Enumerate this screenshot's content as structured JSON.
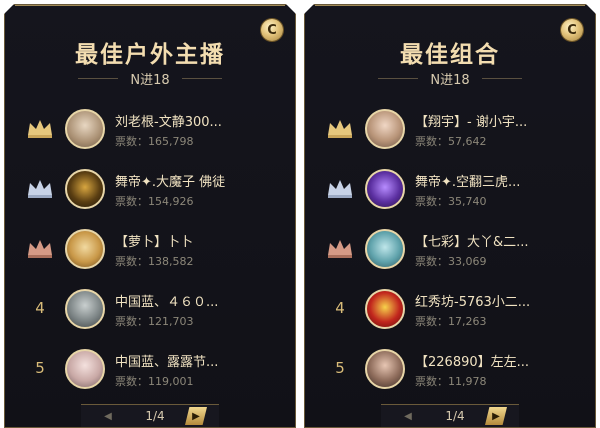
{
  "colors": {
    "gold": "#d9bc79",
    "title": "#f3ddb0",
    "panel_bg": "#15151d",
    "border": "#6a5a3a"
  },
  "panels": [
    {
      "title": "最佳户外主播",
      "subtitle": "N进18",
      "badge": "C",
      "pager": {
        "prev": "◀",
        "next": "▶",
        "text": "1/4"
      },
      "entries": [
        {
          "rank": "1",
          "rank_type": "crown-gold",
          "name": "刘老根-文静300...",
          "votes": "票数：165,798",
          "avatar": "avatar-1"
        },
        {
          "rank": "2",
          "rank_type": "crown-silver",
          "name": "舞帝✦.大魔子 佛徒",
          "votes": "票数：154,926",
          "avatar": "avatar-2"
        },
        {
          "rank": "3",
          "rank_type": "crown-bronze",
          "name": "【萝卜】卜卜",
          "votes": "票数：138,582",
          "avatar": "avatar-3"
        },
        {
          "rank": "4",
          "rank_type": "number",
          "name": "中国蓝、４６０...",
          "votes": "票数：121,703",
          "avatar": "avatar-4"
        },
        {
          "rank": "5",
          "rank_type": "number",
          "name": "中国蓝、露露节...",
          "votes": "票数：119,001",
          "avatar": "avatar-5"
        }
      ]
    },
    {
      "title": "最佳组合",
      "subtitle": "N进18",
      "badge": "C",
      "pager": {
        "prev": "◀",
        "next": "▶",
        "text": "1/4"
      },
      "entries": [
        {
          "rank": "1",
          "rank_type": "crown-gold",
          "name": "【翔宇】- 谢小宇...",
          "votes": "票数：57,642",
          "avatar": "avatar-6"
        },
        {
          "rank": "2",
          "rank_type": "crown-silver",
          "name": "舞帝✦.空翻三虎...",
          "votes": "票数：35,740",
          "avatar": "avatar-7"
        },
        {
          "rank": "3",
          "rank_type": "crown-bronze",
          "name": "【七彩】大丫&二...",
          "votes": "票数：33,069",
          "avatar": "avatar-8"
        },
        {
          "rank": "4",
          "rank_type": "number",
          "name": "红秀坊-5763小二...",
          "votes": "票数：17,263",
          "avatar": "avatar-9"
        },
        {
          "rank": "5",
          "rank_type": "number",
          "name": "【226890】左左...",
          "votes": "票数：11,978",
          "avatar": "avatar-10"
        }
      ]
    }
  ]
}
